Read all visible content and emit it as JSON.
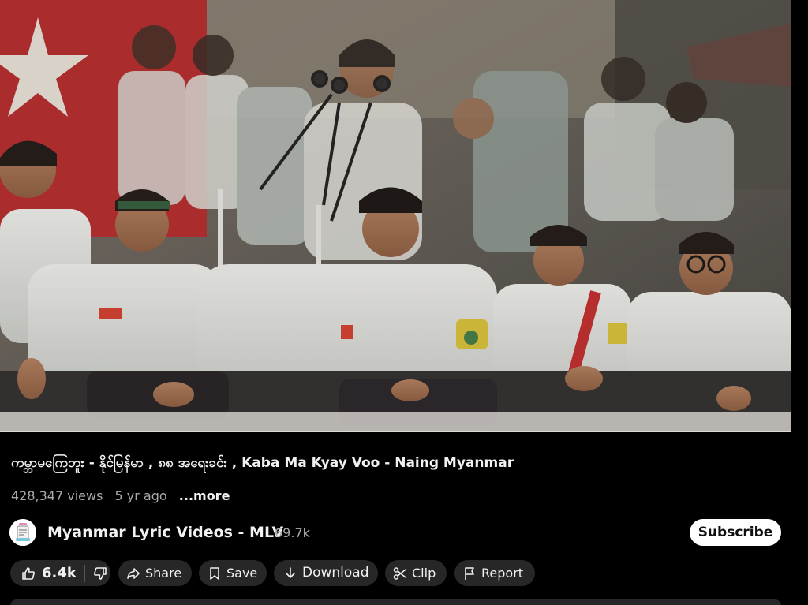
{
  "video": {
    "scene": "protest-stage-photo"
  },
  "title": "ကမ္ဘာမကြေဘူး - နိုင်မြန်မာ , ၈၈ အရေးခင်း , Kaba Ma Kyay Voo - Naing Myanmar",
  "meta": {
    "views": "428,347 views",
    "age": "5 yr ago",
    "more_label": "...more"
  },
  "channel": {
    "name": "Myanmar Lyric Videos - MLV",
    "subscribers": "69.7k",
    "avatar_icon": "mlv-logo-icon",
    "subscribe_label": "Subscribe"
  },
  "actions": {
    "like_count": "6.4k",
    "share_label": "Share",
    "save_label": "Save",
    "download_label": "Download",
    "clip_label": "Clip",
    "report_label": "Report"
  },
  "colors": {
    "background": "#000000",
    "chip_background": "#272727",
    "primary_text": "#f1f1f1",
    "secondary_text": "#aaaaaa",
    "subscribe_background": "#ffffff"
  }
}
